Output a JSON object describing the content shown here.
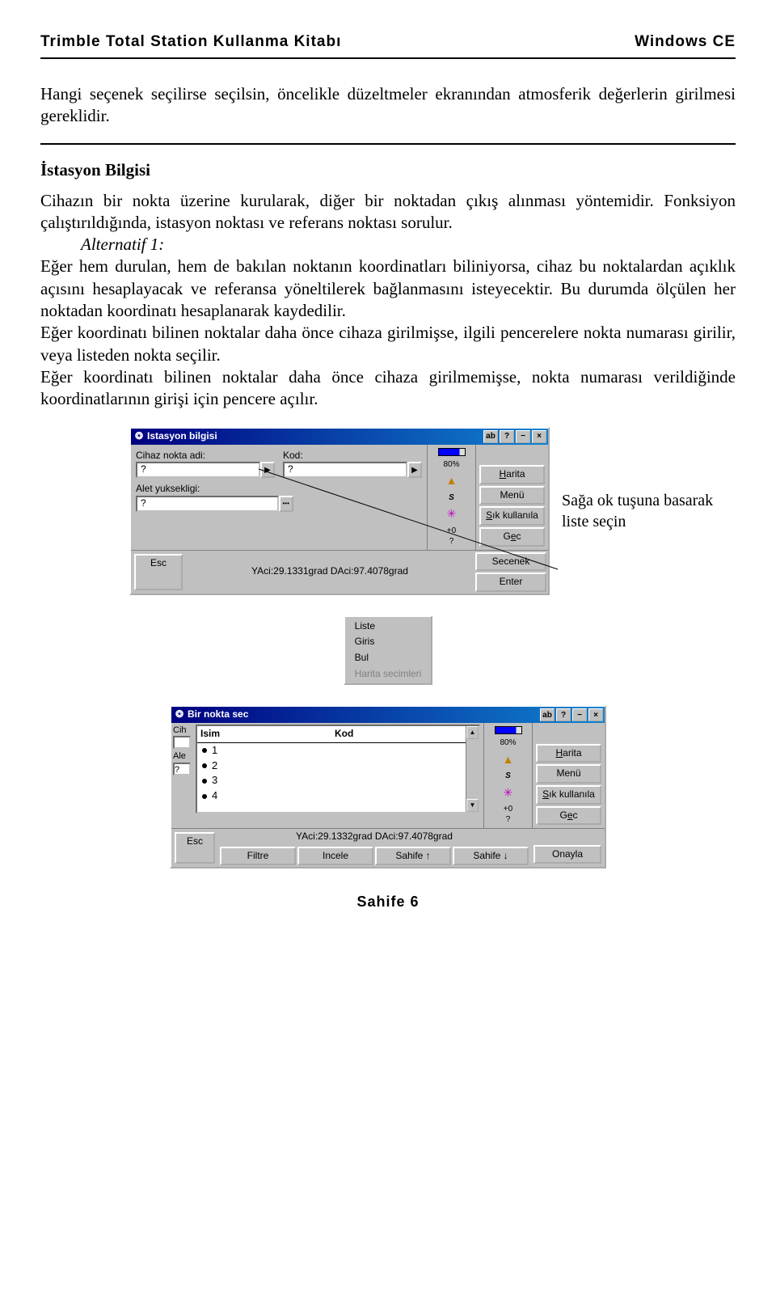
{
  "header": {
    "left": "Trimble Total Station Kullanma Kitabı",
    "right": "Windows CE"
  },
  "intro": "Hangi seçenek seçilirse seçilsin, öncelikle düzeltmeler ekranından atmosferik değerlerin girilmesi gereklidir.",
  "section_title": "İstasyon Bilgisi",
  "para1": "Cihazın bir nokta üzerine kurularak, diğer bir noktadan çıkış alınması yöntemidir. Fonksiyon çalıştırıldığında, istasyon noktası ve referans noktası sorulur.",
  "alt1_label": "Alternatif 1:",
  "para2": "Eğer hem durulan, hem de bakılan noktanın koordinatları biliniyorsa, cihaz bu noktalardan açıklık açısını hesaplayacak ve referansa yöneltilerek bağlanmasını isteyecektir. Bu durumda ölçülen her noktadan koordinatı hesaplanarak kaydedilir.",
  "para3": "Eğer koordinatı bilinen noktalar daha önce cihaza girilmişse, ilgili pencerelere nokta numarası girilir, veya listeden nokta seçilir.",
  "para4": "Eğer koordinatı bilinen noktalar daha önce cihaza girilmemişse, nokta numarası verildiğinde koordinatlarının girişi için pencere açılır.",
  "fig1": {
    "title": "Istasyon bilgisi",
    "ab": "ab",
    "labels": {
      "cihaz_nokta": "Cihaz nokta adi:",
      "kod": "Kod:",
      "alet_yuk": "Alet yuksekligi:"
    },
    "inputs": {
      "p1": "?",
      "p2": "?",
      "p3": "?"
    },
    "status_text": "YAci:29.1331grad  DAci:97.4078grad",
    "buttons": {
      "harita": "Harita",
      "menu": "Menü",
      "sik": "Sık kullanıla",
      "gec": "Gec",
      "enter": "Enter",
      "esc": "Esc",
      "secenek": "Secenek"
    },
    "status": {
      "battery": "80%",
      "s": "S",
      "plus0": "+0",
      "q": "?"
    }
  },
  "annotation1": "Sağa ok tuşuna basarak liste seçin",
  "popup": {
    "items": [
      "Liste",
      "Giris",
      "Bul",
      "Harita secimleri"
    ]
  },
  "fig2": {
    "title": "Bir nokta sec",
    "ab": "ab",
    "left_labels": {
      "cih": "Cih",
      "ale": "Ale"
    },
    "left_q": "?",
    "list_headers": {
      "isim": "Isim",
      "kod": "Kod"
    },
    "list_rows": [
      "1",
      "2",
      "3",
      "4"
    ],
    "status_text": "YAci:29.1332grad  DAci:97.4078grad",
    "buttons": {
      "harita": "Harita",
      "menu": "Menü",
      "sik": "Sık kullanıla",
      "gec": "Gec",
      "onayla": "Onayla",
      "esc": "Esc",
      "filtre": "Filtre",
      "incele": "Incele",
      "sahife_up": "Sahife ↑",
      "sahife_down": "Sahife ↓"
    },
    "status": {
      "battery": "80%",
      "s": "S",
      "plus0": "+0",
      "q": "?"
    }
  },
  "footer": "Sahife 6"
}
